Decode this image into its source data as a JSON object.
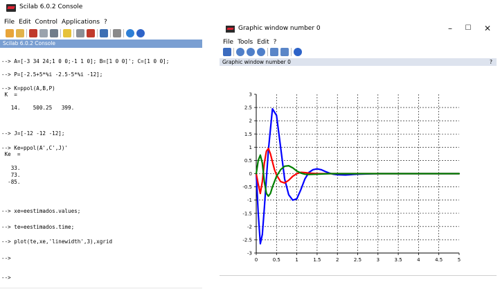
{
  "console": {
    "title": "Scilab 6.0.2 Console",
    "menu": [
      "File",
      "Edit",
      "Control",
      "Applications",
      "?"
    ],
    "header": "Scilab 6.0.2 Console",
    "lines": [
      "--> A=[-3 34 24;1 0 0;-1 1 0]; B=[1 0 0]'; C=[1 0 0];",
      "--> P=[-2.5+5*%i -2.5-5*%i -12];",
      "--> K=ppol(A,B,P)",
      " K  =",
      "   14.    500.25   399.",
      "--> J=[-12 -12 -12];",
      "--> Ke=ppol(A',C',J)'",
      " Ke  =",
      "   33.",
      "   73.",
      "  -85.",
      "--> xe=eestimados.values;",
      "--> te=eestimados.time;",
      "--> plot(te,xe,'linewidth',3),xgrid",
      "-->",
      "-->"
    ]
  },
  "graphic": {
    "title": "Graphic window number 0",
    "controls": [
      "–",
      "☐",
      "✕"
    ],
    "menu": [
      "File",
      "Tools",
      "Edit",
      "?"
    ],
    "header": "Graphic window number 0",
    "help": "?"
  },
  "chart_data": {
    "type": "line",
    "xlim": [
      0,
      5
    ],
    "ylim": [
      -3,
      3
    ],
    "xticks": [
      "0",
      "0.5",
      "1",
      "1.5",
      "2",
      "2.5",
      "3",
      "3.5",
      "4",
      "4.5",
      "5"
    ],
    "yticks": [
      "-3",
      "-2.5",
      "-2",
      "-1.5",
      "-1",
      "-0.5",
      "0",
      "0.5",
      "1",
      "1.5",
      "2",
      "2.5",
      "3"
    ],
    "grid": true,
    "series": [
      {
        "color": "#0000ff",
        "x": [
          0,
          0.05,
          0.1,
          0.15,
          0.2,
          0.3,
          0.4,
          0.5,
          0.6,
          0.7,
          0.8,
          0.9,
          1.0,
          1.1,
          1.2,
          1.3,
          1.4,
          1.5,
          1.6,
          1.7,
          1.8,
          1.9,
          2.0,
          2.2,
          2.5,
          3,
          3.5,
          4,
          4.5,
          5
        ],
        "y": [
          0,
          -1.5,
          -2.65,
          -2.3,
          -1.3,
          0.9,
          2.45,
          2.2,
          1.0,
          -0.2,
          -0.8,
          -1.0,
          -0.95,
          -0.6,
          -0.2,
          0.05,
          0.15,
          0.18,
          0.15,
          0.08,
          0.02,
          -0.02,
          -0.04,
          -0.05,
          -0.02,
          0,
          0,
          0,
          0,
          0
        ]
      },
      {
        "color": "#ff0000",
        "x": [
          0,
          0.05,
          0.1,
          0.15,
          0.2,
          0.25,
          0.3,
          0.35,
          0.4,
          0.45,
          0.5,
          0.6,
          0.7,
          0.8,
          0.9,
          1.0,
          1.1,
          1.2,
          1.3,
          1.5,
          1.8,
          2.2,
          3,
          4,
          5
        ],
        "y": [
          0,
          -0.4,
          -0.75,
          -0.3,
          0.4,
          0.85,
          0.95,
          0.75,
          0.45,
          0.15,
          -0.05,
          -0.3,
          -0.35,
          -0.25,
          -0.1,
          0.0,
          0.05,
          0.04,
          0.02,
          0.0,
          0,
          0,
          0,
          0,
          0
        ]
      },
      {
        "color": "#008000",
        "x": [
          0,
          0.05,
          0.1,
          0.15,
          0.2,
          0.25,
          0.3,
          0.35,
          0.4,
          0.5,
          0.6,
          0.7,
          0.8,
          0.9,
          1.0,
          1.1,
          1.2,
          1.3,
          1.5,
          1.8,
          2.2,
          3,
          4,
          5
        ],
        "y": [
          0,
          0.5,
          0.7,
          0.4,
          -0.3,
          -0.75,
          -0.85,
          -0.75,
          -0.5,
          -0.1,
          0.15,
          0.28,
          0.3,
          0.22,
          0.1,
          0.02,
          -0.02,
          -0.03,
          -0.02,
          0,
          0,
          0,
          0,
          0
        ]
      }
    ]
  }
}
